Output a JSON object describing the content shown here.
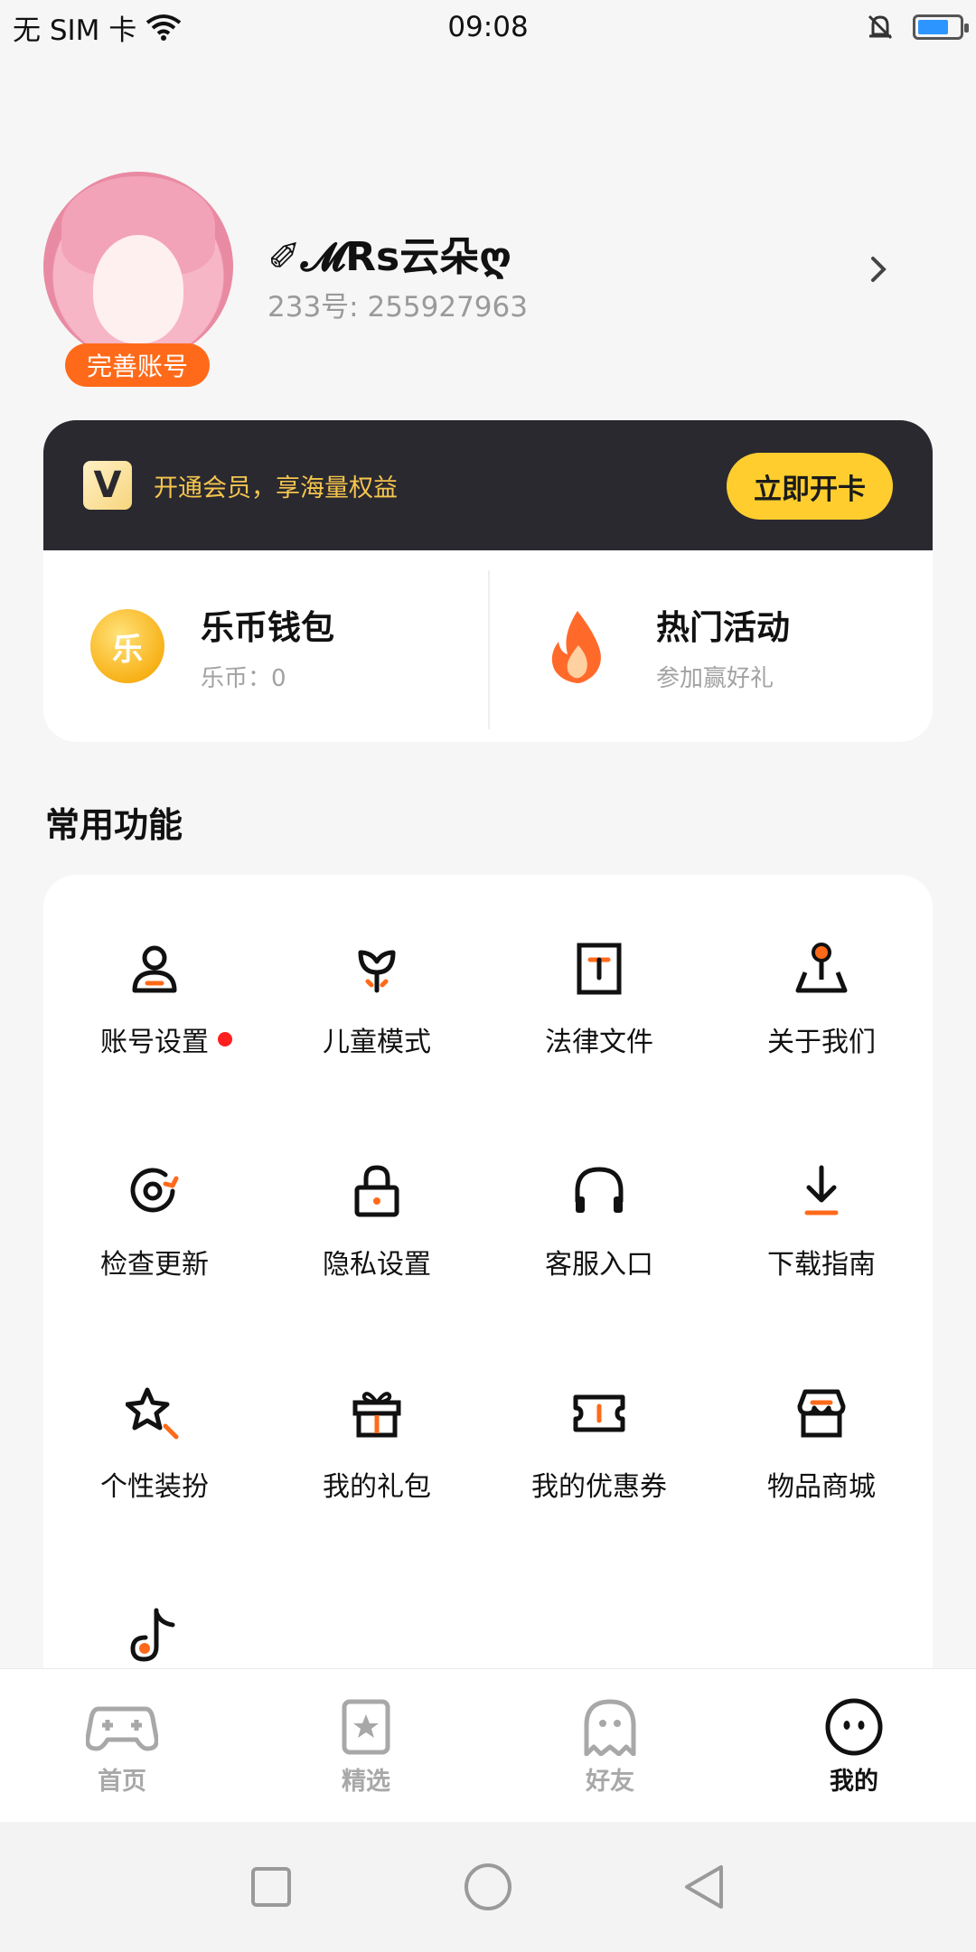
{
  "status_bar": {
    "carrier": "无 SIM 卡",
    "time": "09:08",
    "battery_level": 0.75,
    "icons": [
      "wifi-icon",
      "bell-off-icon",
      "battery-icon"
    ]
  },
  "profile": {
    "nickname": "✐𝓜Rs云朵ღ",
    "account_id": "233号: 255927963",
    "badge_label": "完善账号"
  },
  "vip": {
    "logo_letter": "V",
    "promo_text": "开通会员，享海量权益",
    "button_label": "立即开卡"
  },
  "wallet": {
    "coin_glyph": "乐",
    "title": "乐币钱包",
    "subtitle": "乐币：0"
  },
  "activity": {
    "title": "热门活动",
    "subtitle": "参加赢好礼"
  },
  "common_functions": {
    "title": "常用功能",
    "items": [
      {
        "label": "账号设置",
        "icon": "user-icon",
        "notify": true
      },
      {
        "label": "儿童模式",
        "icon": "sprout-icon"
      },
      {
        "label": "法律文件",
        "icon": "document-icon"
      },
      {
        "label": "关于我们",
        "icon": "location-pin-icon"
      },
      {
        "label": "检查更新",
        "icon": "refresh-icon"
      },
      {
        "label": "隐私设置",
        "icon": "lock-icon"
      },
      {
        "label": "客服入口",
        "icon": "headphones-icon"
      },
      {
        "label": "下载指南",
        "icon": "download-icon"
      },
      {
        "label": "个性装扮",
        "icon": "star-wand-icon"
      },
      {
        "label": "我的礼包",
        "icon": "gift-icon"
      },
      {
        "label": "我的优惠券",
        "icon": "ticket-icon"
      },
      {
        "label": "物品商城",
        "icon": "store-icon"
      },
      {
        "label": "",
        "icon": "tiktok-icon"
      }
    ]
  },
  "bottom_nav": {
    "items": [
      {
        "label": "首页",
        "icon": "gamepad-icon"
      },
      {
        "label": "精选",
        "icon": "star-card-icon"
      },
      {
        "label": "好友",
        "icon": "ghost-icon"
      },
      {
        "label": "我的",
        "icon": "face-icon",
        "active": true
      }
    ]
  },
  "colors": {
    "accent": "#ff6a1a",
    "vip_bg": "#2a2930",
    "vip_text": "#f5c54e",
    "vip_button": "#ffce2e"
  }
}
